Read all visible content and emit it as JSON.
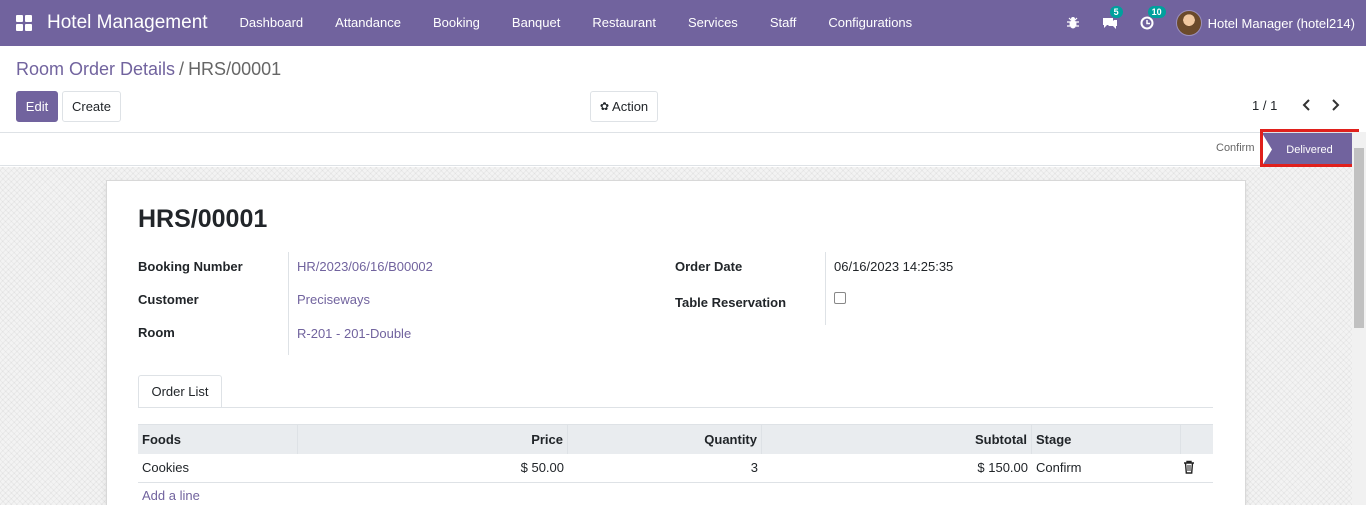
{
  "navbar": {
    "brand": "Hotel Management",
    "menu": [
      "Dashboard",
      "Attandance",
      "Booking",
      "Banquet",
      "Restaurant",
      "Services",
      "Staff",
      "Configurations"
    ],
    "messages_count": "5",
    "activities_count": "10",
    "user": "Hotel Manager (hotel214)"
  },
  "breadcrumb": {
    "parent": "Room Order Details",
    "separator": "/",
    "current": "HRS/00001"
  },
  "controls": {
    "edit": "Edit",
    "create": "Create",
    "action": "Action",
    "pager": "1 / 1"
  },
  "statusbar": {
    "stages": [
      "Confirm",
      "Delivered"
    ],
    "active": "Delivered"
  },
  "form": {
    "title": "HRS/00001",
    "left_fields": [
      {
        "label": "Booking Number",
        "value": "HR/2023/06/16/B00002"
      },
      {
        "label": "Customer",
        "value": "Preciseways"
      },
      {
        "label": "Room",
        "value": "R-201 - 201-Double"
      }
    ],
    "right_fields": [
      {
        "label": "Order Date",
        "value": "06/16/2023 14:25:35"
      },
      {
        "label": "Table Reservation",
        "value": ""
      }
    ],
    "tab": "Order List",
    "table": {
      "headers": [
        "Foods",
        "Price",
        "Quantity",
        "Subtotal",
        "Stage"
      ],
      "rows": [
        {
          "food": "Cookies",
          "price": "$ 50.00",
          "quantity": "3",
          "subtotal": "$ 150.00",
          "stage": "Confirm"
        }
      ],
      "add_line": "Add a line"
    }
  },
  "colors": {
    "brand": "#71639e",
    "highlight": "#e0201c",
    "badge": "#00a09d"
  }
}
